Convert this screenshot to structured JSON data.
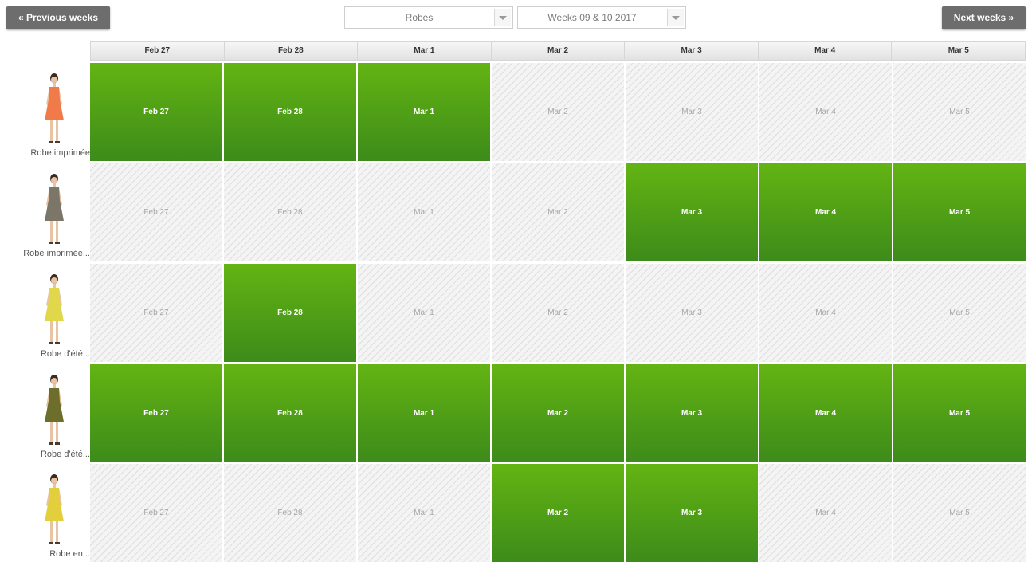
{
  "nav": {
    "previous_label": "« Previous weeks",
    "next_label": "Next weeks »"
  },
  "filters": {
    "category": "Robes",
    "weeks": "Weeks 09 & 10 2017"
  },
  "days": [
    "Feb 27",
    "Feb 28",
    "Mar 1",
    "Mar 2",
    "Mar 3",
    "Mar 4",
    "Mar 5"
  ],
  "products": [
    {
      "name": "Robe imprimée",
      "dress_color": "#f07a4a",
      "available": [
        true,
        true,
        true,
        false,
        false,
        false,
        false
      ]
    },
    {
      "name": "Robe imprimée...",
      "dress_color": "#7c7668",
      "available": [
        false,
        false,
        false,
        false,
        true,
        true,
        true
      ]
    },
    {
      "name": "Robe d'été...",
      "dress_color": "#e0d84a",
      "available": [
        false,
        true,
        false,
        false,
        false,
        false,
        false
      ]
    },
    {
      "name": "Robe d'été...",
      "dress_color": "#6e6e2c",
      "available": [
        true,
        true,
        true,
        true,
        true,
        true,
        true
      ]
    },
    {
      "name": "Robe en...",
      "dress_color": "#e3cf3c",
      "available": [
        false,
        false,
        false,
        true,
        true,
        false,
        false
      ]
    }
  ],
  "colors": {
    "available_top": "#63b413",
    "available_bottom": "#3d8b1a",
    "nav_button": "#6d6d6d"
  }
}
